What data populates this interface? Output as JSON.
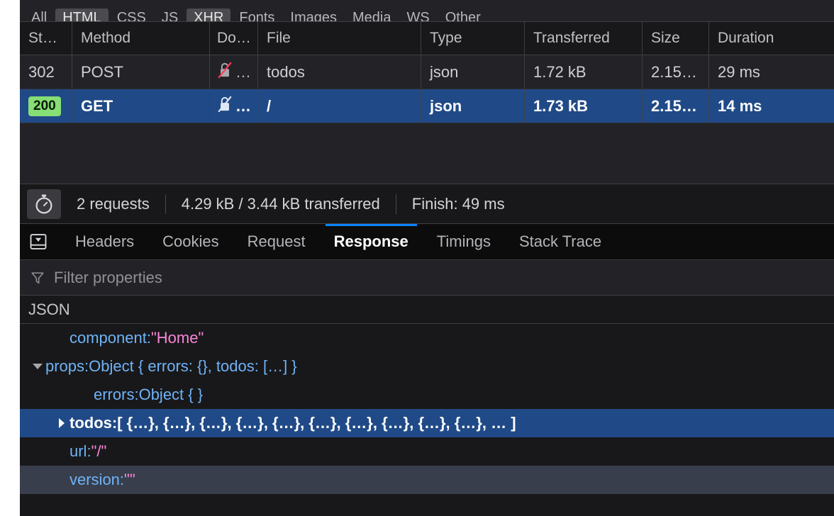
{
  "filter_bar": {
    "items": [
      {
        "label": "All",
        "active": false
      },
      {
        "label": "HTML",
        "active": true
      },
      {
        "label": "CSS",
        "active": false
      },
      {
        "label": "JS",
        "active": false
      },
      {
        "label": "XHR",
        "active": true
      },
      {
        "label": "Fonts",
        "active": false
      },
      {
        "label": "Images",
        "active": false
      },
      {
        "label": "Media",
        "active": false
      },
      {
        "label": "WS",
        "active": false
      },
      {
        "label": "Other",
        "active": false
      }
    ]
  },
  "network_table": {
    "headers": {
      "status": "St…",
      "method": "Method",
      "domain": "Do…",
      "file": "File",
      "type": "Type",
      "transferred": "Transferred",
      "size": "Size",
      "duration": "Duration"
    },
    "rows": [
      {
        "status": "302",
        "method": "POST",
        "domain_icon": "insecure-lock-icon",
        "domain": "…",
        "file": "todos",
        "type": "json",
        "transferred": "1.72 kB",
        "size": "2.15…",
        "duration": "29 ms",
        "selected": false
      },
      {
        "status": "200",
        "method": "GET",
        "domain_icon": "insecure-lock-icon",
        "domain": "…",
        "file": "/",
        "type": "json",
        "transferred": "1.73 kB",
        "size": "2.15…",
        "duration": "14 ms",
        "selected": true
      }
    ]
  },
  "summary": {
    "stopwatch_icon": "stopwatch-icon",
    "requests": "2 requests",
    "transferred": "4.29 kB / 3.44 kB transferred",
    "finish": "Finish: 49 ms"
  },
  "detail_tabs": {
    "panel_icon": "toggle-panel-icon",
    "tabs": [
      {
        "label": "Headers",
        "active": false
      },
      {
        "label": "Cookies",
        "active": false
      },
      {
        "label": "Request",
        "active": false
      },
      {
        "label": "Response",
        "active": true
      },
      {
        "label": "Timings",
        "active": false
      },
      {
        "label": "Stack Trace",
        "active": false
      }
    ]
  },
  "properties_filter": {
    "icon": "funnel-icon",
    "placeholder": "Filter properties"
  },
  "json_viewer": {
    "title": "JSON",
    "rows": [
      {
        "indent": 1,
        "twisty": "none",
        "key": "component",
        "separator": ": ",
        "value": "\"Home\"",
        "value_kind": "string",
        "selected": false,
        "stripe": false
      },
      {
        "indent": 0,
        "twisty": "open",
        "key": "props",
        "separator": ": ",
        "value": "Object { errors: {}, todos: […] }",
        "value_kind": "object",
        "selected": false,
        "stripe": false
      },
      {
        "indent": 2,
        "twisty": "none",
        "key": "errors",
        "separator": ": ",
        "value": "Object { }",
        "value_kind": "object",
        "selected": false,
        "stripe": false
      },
      {
        "indent": 1,
        "twisty": "closed",
        "key": "todos",
        "separator": ": ",
        "value": "[ {…}, {…}, {…}, {…}, {…}, {…}, {…}, {…}, {…}, {…}, … ]",
        "value_kind": "object",
        "selected": true,
        "stripe": false
      },
      {
        "indent": 1,
        "twisty": "none",
        "key": "url",
        "separator": ": ",
        "value": "\"/\"",
        "value_kind": "string",
        "selected": false,
        "stripe": false
      },
      {
        "indent": 1,
        "twisty": "none",
        "key": "version",
        "separator": ": ",
        "value": "\"\"",
        "value_kind": "string",
        "selected": false,
        "stripe": true
      }
    ]
  },
  "colors": {
    "accent_blue": "#0a84ff",
    "selection_blue": "#204a87",
    "status_ok_green": "#86de74",
    "json_key_blue": "#6fb3f7",
    "json_string_pink": "#f886d6",
    "insecure_red": "#ff3b5c",
    "panel_bg": "#18181a",
    "row_bg": "#232327"
  }
}
